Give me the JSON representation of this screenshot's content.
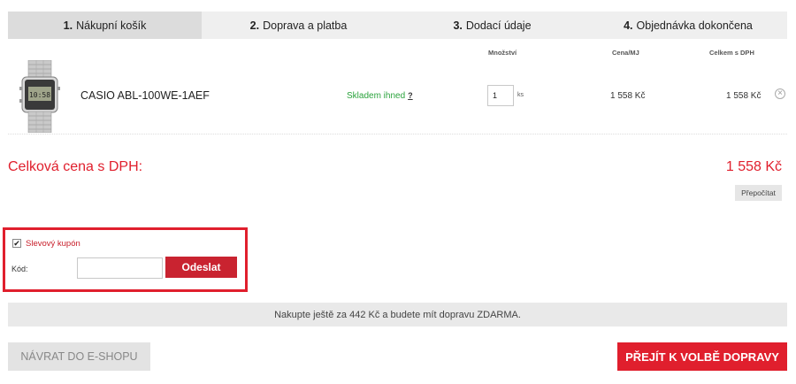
{
  "steps": [
    {
      "num": "1.",
      "label": "Nákupní košík",
      "active": true
    },
    {
      "num": "2.",
      "label": "Doprava a platba",
      "active": false
    },
    {
      "num": "3.",
      "label": "Dodací údaje",
      "active": false
    },
    {
      "num": "4.",
      "label": "Objednávka dokončena",
      "active": false
    }
  ],
  "table_headers": {
    "quantity": "Množství",
    "unit_price": "Cena/MJ",
    "total_with_vat": "Celkem s DPH"
  },
  "cart_items": [
    {
      "name": "CASIO ABL-100WE-1AEF",
      "stock": "Skladem ihned",
      "stock_help": "?",
      "quantity": "1",
      "quantity_unit": "ks",
      "unit_price": "1 558 Kč",
      "total": "1 558 Kč",
      "remove_icon": "×"
    }
  ],
  "totals": {
    "label": "Celková cena s DPH:",
    "value": "1 558 Kč",
    "recalculate": "Přepočítat"
  },
  "coupon": {
    "checked": true,
    "check_mark": "✔",
    "label": "Slevový kupón",
    "code_label": "Kód:",
    "code_value": "",
    "submit": "Odeslat"
  },
  "shipping_info": "Nakupte ještě za 442 Kč a budete mít dopravu ZDARMA.",
  "buttons": {
    "back": "NÁVRAT DO E-SHOPU",
    "next": "PŘEJÍT K VOLBĚ DOPRAVY"
  },
  "colors": {
    "accent_red": "#e01f2d",
    "stock_green": "#2ba33d",
    "step_active_bg": "#dcdcdc"
  }
}
